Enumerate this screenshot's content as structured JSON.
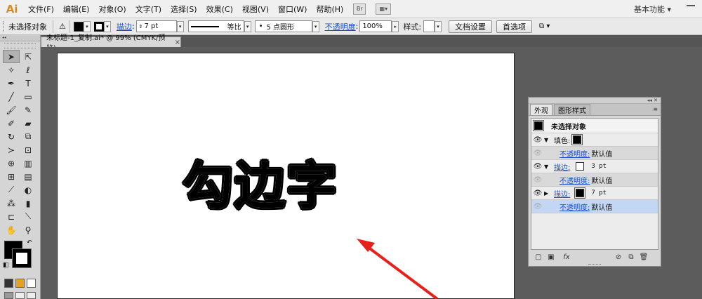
{
  "app": {
    "logo": "Ai"
  },
  "menubar": {
    "items": [
      "文件(F)",
      "编辑(E)",
      "对象(O)",
      "文字(T)",
      "选择(S)",
      "效果(C)",
      "视图(V)",
      "窗口(W)",
      "帮助(H)"
    ],
    "bridge_label": "Br",
    "workspace": "基本功能"
  },
  "controlbar": {
    "selection": "未选择对象",
    "stroke_label": "描边",
    "stroke_weight": "7 pt",
    "profile": "等比",
    "brush": "5 点圆形",
    "opacity_label": "不透明度",
    "opacity_value": "100%",
    "style_label": "样式",
    "doc_setup": "文档设置",
    "preferences": "首选项"
  },
  "document": {
    "tab_title": "未标题-1_复制.ai* @ 99% (CMYK/预览)",
    "close": "×"
  },
  "canvas": {
    "artwork_text": "勾边字",
    "arrow_color": "#e8201c"
  },
  "appearance_panel": {
    "tabs": [
      "外观",
      "图形样式"
    ],
    "header": "未选择对象",
    "rows": [
      {
        "label": "填色:",
        "type": "fill"
      },
      {
        "label": "不透明度:",
        "value": "默认值",
        "type": "sub"
      },
      {
        "label": "描边:",
        "value": "3 pt",
        "type": "stroke_white"
      },
      {
        "label": "不透明度:",
        "value": "默认值",
        "type": "sub"
      },
      {
        "label": "描边:",
        "value": "7 pt",
        "type": "stroke_black"
      },
      {
        "label": "不透明度:",
        "value": "默认值",
        "type": "selected"
      }
    ],
    "fx_label": "fx"
  }
}
